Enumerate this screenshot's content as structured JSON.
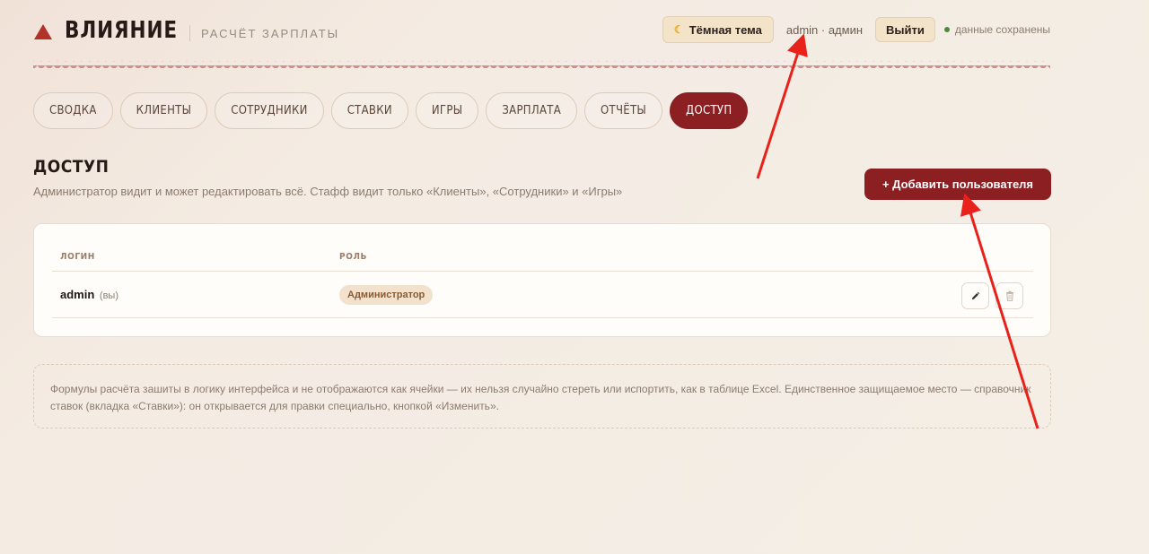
{
  "header": {
    "logo_name": "ВЛИЯНИЕ",
    "logo_sub": "РАСЧЁТ ЗАРПЛАТЫ",
    "theme_button": "Тёмная тема",
    "user_info": "admin · админ",
    "logout_button": "Выйти",
    "saved_status": "данные сохранены"
  },
  "tabs": [
    {
      "label": "СВОДКА"
    },
    {
      "label": "КЛИЕНТЫ"
    },
    {
      "label": "СОТРУДНИКИ"
    },
    {
      "label": "СТАВКИ"
    },
    {
      "label": "ИГРЫ"
    },
    {
      "label": "ЗАРПЛАТА"
    },
    {
      "label": "ОТЧЁТЫ"
    },
    {
      "label": "ДОСТУП",
      "active": true
    }
  ],
  "section": {
    "title": "ДОСТУП",
    "description": "Администратор видит и может редактировать всё. Стафф видит только «Клиенты», «Сотрудники» и «Игры»",
    "add_button": "+ Добавить пользователя"
  },
  "table": {
    "columns": [
      "ЛОГИН",
      "РОЛЬ"
    ],
    "rows": [
      {
        "login": "admin",
        "login_note": "(вы)",
        "role": "Администратор"
      }
    ]
  },
  "note": "Формулы расчёта зашиты в логику интерфейса и не отображаются как ячейки — их нельзя случайно стереть или испортить, как в таблице Excel. Единственное защищаемое место — справочник ставок (вкладка «Ставки»): он открывается для правки специально, кнопкой «Изменить».",
  "icons": {
    "logo": "triangle-logo-icon",
    "theme": "moon-icon",
    "edit": "pencil-icon",
    "delete": "trash-icon"
  },
  "colors": {
    "accent": "#8b1f22",
    "logo_red": "#b1312b",
    "status_green": "#4e8a3d",
    "annotation_arrow": "#e8211a"
  }
}
